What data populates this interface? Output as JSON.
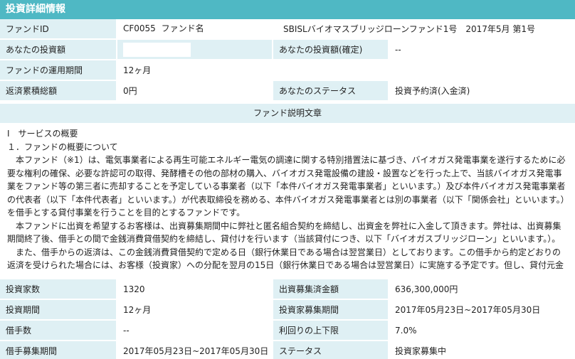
{
  "header": {
    "title": "投資詳細情報"
  },
  "top": {
    "fund_id_label": "ファンドID",
    "fund_id_value": "CF0055",
    "fund_name_label": "ファンド名",
    "fund_name_value": "SBISLバイオマスブリッジローンファンド1号　2017年5月 第1号",
    "your_investment_label": "あなたの投資額",
    "your_investment_value": "",
    "your_investment_confirmed_label": "あなたの投資額(確定)",
    "your_investment_confirmed_value": "--",
    "period_label": "ファンドの運用期間",
    "period_value": "12ヶ月",
    "repaid_label": "返済累積総額",
    "repaid_value": "0円",
    "status_label": "あなたのステータス",
    "status_value": "投資予約済(入金済)"
  },
  "description": {
    "section_title": "ファンド説明文章",
    "lines": [
      "Ⅰ　サービスの概要",
      "１．ファンドの概要について",
      "　本ファンド（※1）は、電気事業者による再生可能エネルギー電気の調達に関する特別措置法に基づき、バイオガス発電事業を遂行するために必要な権利の確保、必要な許認可の取得、発酵槽その他の部材の購入、バイオガス発電設備の建設・設置などを行った上で、当該バイオガス発電事業をファンド等の第三者に売却することを予定している事業者（以下「本件バイオガス発電事業者」といいます。）及び本件バイオガス発電事業者の代表者（以下「本件代表者」といいます。）が代表取締役を務める、本件バイオガス発電事業者とは別の事業者（以下「関係会社」といいます。）を借手とする貸付事業を行うことを目的とするファンドです。",
      "　本ファンドに出資を希望するお客様は、出資募集期間中に弊社と匿名組合契約を締結し、出資金を弊社に入金して頂きます。弊社は、出資募集期間終了後、借手との間で金銭消費貸借契約を締結し、貸付けを行います（当該貸付につき、以下「バイオガスブリッジローン」といいます。）。",
      "　また、借手からの返済は、この金銭消費貸借契約で定める日（銀行休業日である場合は翌営業日）としております。この借手から約定どおりの返済を受けられた場合には、お客様（投資家）への分配を翌月の15日（銀行休業日である場合は翌営業日）に実施する予定です。但し、貸付元金"
    ]
  },
  "bottom": {
    "investors_label": "投資家数",
    "investors_value": "1320",
    "raised_label": "出資募集済金額",
    "raised_value": "636,300,000円",
    "invest_period_label": "投資期間",
    "invest_period_value": "12ヶ月",
    "recruit_period_label": "投資家募集期間",
    "recruit_period_value": "2017年05月23日~2017年05月30日",
    "borrowers_label": "借手数",
    "borrowers_value": "--",
    "yield_label": "利回りの上下限",
    "yield_value": "7.0%",
    "borrower_recruit_label": "借手募集期間",
    "borrower_recruit_value": "2017年05月23日~2017年05月30日",
    "status_label": "ステータス",
    "status_value": "投資家募集中"
  }
}
